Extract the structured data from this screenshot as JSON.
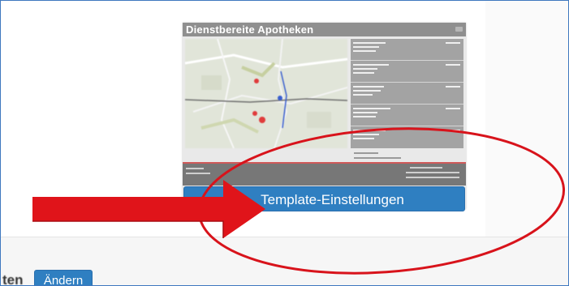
{
  "preview": {
    "title": "Dienstbereite Apotheken",
    "map_marker_color": "#e03c3c",
    "map_route_color": "#3a5fcf",
    "list_background": "#a3a3a3",
    "header_background": "#8f8f8f"
  },
  "template_button": {
    "label": "Template-Einstellungen"
  },
  "bottom_row": {
    "partial_label": "ten",
    "change_button": "Ändern"
  },
  "annotations": {
    "arrow_color": "#e0141a",
    "ellipse_color": "#d8131b",
    "arrow_icon": "right-arrow-icon",
    "ellipse_icon": "highlight-ellipse-icon"
  },
  "accent_color": "#2f7fc1"
}
